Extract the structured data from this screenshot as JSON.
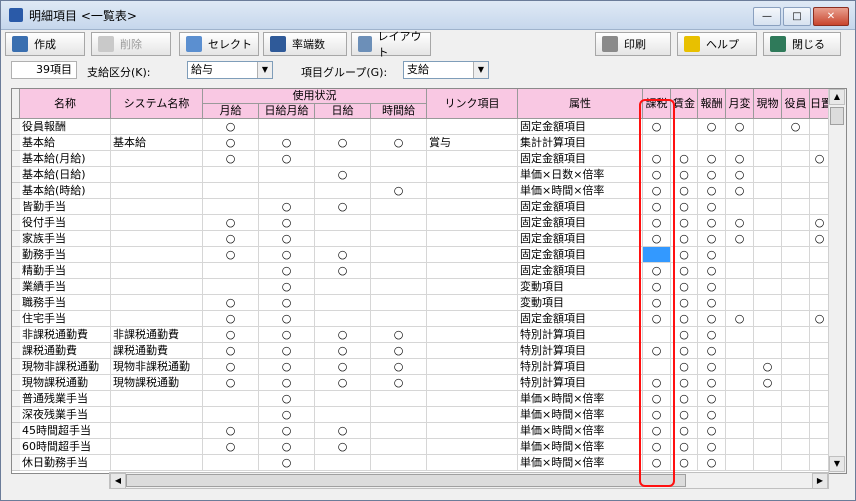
{
  "window": {
    "title": "明細項目 <一覧表>"
  },
  "toolbar": {
    "create": "作成",
    "delete": "削除",
    "select": "セレクト",
    "rounding": "率端数",
    "layout": "レイアウト",
    "print": "印刷",
    "help": "ヘルプ",
    "close": "閉じる"
  },
  "filters": {
    "count": "39項目",
    "payment_label": "支給区分(K):",
    "payment_value": "給与",
    "group_label": "項目グループ(G):",
    "group_value": "支給"
  },
  "columns": {
    "name": "名称",
    "system_name": "システム名称",
    "usage": "使用状況",
    "monthly": "月給",
    "daily_monthly": "日給月給",
    "daily": "日給",
    "hourly": "時間給",
    "link": "リンク項目",
    "attribute": "属性",
    "tax": "課税",
    "wage": "賃金",
    "remuneration": "報酬",
    "monthly_change": "月変",
    "in_kind": "現物",
    "officer": "役員",
    "daily_cut": "日置"
  },
  "rows": [
    {
      "name": "役員報酬",
      "sys": "",
      "m": "○",
      "dm": "",
      "d": "",
      "h": "",
      "link": "",
      "attr": "固定金額項目",
      "tax": "○",
      "wage": "",
      "rem": "○",
      "mc": "○",
      "ik": "",
      "off": "○",
      "dc": ""
    },
    {
      "name": "基本給",
      "sys": "基本給",
      "m": "○",
      "dm": "○",
      "d": "○",
      "h": "○",
      "link": "賞与",
      "attr": "集計計算項目",
      "tax": "",
      "wage": "",
      "rem": "",
      "mc": "",
      "ik": "",
      "off": "",
      "dc": ""
    },
    {
      "name": "基本給(月給)",
      "sys": "",
      "m": "○",
      "dm": "○",
      "d": "",
      "h": "",
      "link": "",
      "attr": "固定金額項目",
      "tax": "○",
      "wage": "○",
      "rem": "○",
      "mc": "○",
      "ik": "",
      "off": "",
      "dc": "○"
    },
    {
      "name": "基本給(日給)",
      "sys": "",
      "m": "",
      "dm": "",
      "d": "○",
      "h": "",
      "link": "",
      "attr": "単価×日数×倍率",
      "tax": "○",
      "wage": "○",
      "rem": "○",
      "mc": "○",
      "ik": "",
      "off": "",
      "dc": ""
    },
    {
      "name": "基本給(時給)",
      "sys": "",
      "m": "",
      "dm": "",
      "d": "",
      "h": "○",
      "link": "",
      "attr": "単価×時間×倍率",
      "tax": "○",
      "wage": "○",
      "rem": "○",
      "mc": "○",
      "ik": "",
      "off": "",
      "dc": ""
    },
    {
      "name": "皆勤手当",
      "sys": "",
      "m": "",
      "dm": "○",
      "d": "○",
      "h": "",
      "link": "",
      "attr": "固定金額項目",
      "tax": "○",
      "wage": "○",
      "rem": "○",
      "mc": "",
      "ik": "",
      "off": "",
      "dc": ""
    },
    {
      "name": "役付手当",
      "sys": "",
      "m": "○",
      "dm": "○",
      "d": "",
      "h": "",
      "link": "",
      "attr": "固定金額項目",
      "tax": "○",
      "wage": "○",
      "rem": "○",
      "mc": "○",
      "ik": "",
      "off": "",
      "dc": "○"
    },
    {
      "name": "家族手当",
      "sys": "",
      "m": "○",
      "dm": "○",
      "d": "",
      "h": "",
      "link": "",
      "attr": "固定金額項目",
      "tax": "○",
      "wage": "○",
      "rem": "○",
      "mc": "○",
      "ik": "",
      "off": "",
      "dc": "○"
    },
    {
      "name": "勤務手当",
      "sys": "",
      "m": "○",
      "dm": "○",
      "d": "○",
      "h": "",
      "link": "",
      "attr": "固定金額項目",
      "tax": "",
      "wage": "○",
      "rem": "○",
      "mc": "",
      "ik": "",
      "off": "",
      "dc": ""
    },
    {
      "name": "精勤手当",
      "sys": "",
      "m": "",
      "dm": "○",
      "d": "○",
      "h": "",
      "link": "",
      "attr": "固定金額項目",
      "tax": "○",
      "wage": "○",
      "rem": "○",
      "mc": "",
      "ik": "",
      "off": "",
      "dc": ""
    },
    {
      "name": "業績手当",
      "sys": "",
      "m": "",
      "dm": "○",
      "d": "",
      "h": "",
      "link": "",
      "attr": "変動項目",
      "tax": "○",
      "wage": "○",
      "rem": "○",
      "mc": "",
      "ik": "",
      "off": "",
      "dc": ""
    },
    {
      "name": "職務手当",
      "sys": "",
      "m": "○",
      "dm": "○",
      "d": "",
      "h": "",
      "link": "",
      "attr": "変動項目",
      "tax": "○",
      "wage": "○",
      "rem": "○",
      "mc": "",
      "ik": "",
      "off": "",
      "dc": ""
    },
    {
      "name": "住宅手当",
      "sys": "",
      "m": "○",
      "dm": "○",
      "d": "",
      "h": "",
      "link": "",
      "attr": "固定金額項目",
      "tax": "○",
      "wage": "○",
      "rem": "○",
      "mc": "○",
      "ik": "",
      "off": "",
      "dc": "○"
    },
    {
      "name": "非課税通勤費",
      "sys": "非課税通勤費",
      "m": "○",
      "dm": "○",
      "d": "○",
      "h": "○",
      "link": "",
      "attr": "特別計算項目",
      "tax": "",
      "wage": "○",
      "rem": "○",
      "mc": "",
      "ik": "",
      "off": "",
      "dc": ""
    },
    {
      "name": "課税通勤費",
      "sys": "課税通勤費",
      "m": "○",
      "dm": "○",
      "d": "○",
      "h": "○",
      "link": "",
      "attr": "特別計算項目",
      "tax": "○",
      "wage": "○",
      "rem": "○",
      "mc": "",
      "ik": "",
      "off": "",
      "dc": ""
    },
    {
      "name": "現物非課税通勤",
      "sys": "現物非課税通勤",
      "m": "○",
      "dm": "○",
      "d": "○",
      "h": "○",
      "link": "",
      "attr": "特別計算項目",
      "tax": "",
      "wage": "○",
      "rem": "○",
      "mc": "",
      "ik": "○",
      "off": "",
      "dc": ""
    },
    {
      "name": "現物課税通勤",
      "sys": "現物課税通勤",
      "m": "○",
      "dm": "○",
      "d": "○",
      "h": "○",
      "link": "",
      "attr": "特別計算項目",
      "tax": "○",
      "wage": "○",
      "rem": "○",
      "mc": "",
      "ik": "○",
      "off": "",
      "dc": ""
    },
    {
      "name": "普通残業手当",
      "sys": "",
      "m": "",
      "dm": "○",
      "d": "",
      "h": "",
      "link": "",
      "attr": "単価×時間×倍率",
      "tax": "○",
      "wage": "○",
      "rem": "○",
      "mc": "",
      "ik": "",
      "off": "",
      "dc": ""
    },
    {
      "name": "深夜残業手当",
      "sys": "",
      "m": "",
      "dm": "○",
      "d": "",
      "h": "",
      "link": "",
      "attr": "単価×時間×倍率",
      "tax": "○",
      "wage": "○",
      "rem": "○",
      "mc": "",
      "ik": "",
      "off": "",
      "dc": ""
    },
    {
      "name": "45時間超手当",
      "sys": "",
      "m": "○",
      "dm": "○",
      "d": "○",
      "h": "",
      "link": "",
      "attr": "単価×時間×倍率",
      "tax": "○",
      "wage": "○",
      "rem": "○",
      "mc": "",
      "ik": "",
      "off": "",
      "dc": ""
    },
    {
      "name": "60時間超手当",
      "sys": "",
      "m": "○",
      "dm": "○",
      "d": "○",
      "h": "",
      "link": "",
      "attr": "単価×時間×倍率",
      "tax": "○",
      "wage": "○",
      "rem": "○",
      "mc": "",
      "ik": "",
      "off": "",
      "dc": ""
    },
    {
      "name": "休日勤務手当",
      "sys": "",
      "m": "",
      "dm": "○",
      "d": "",
      "h": "",
      "link": "",
      "attr": "単価×時間×倍率",
      "tax": "○",
      "wage": "○",
      "rem": "○",
      "mc": "",
      "ik": "",
      "off": "",
      "dc": ""
    }
  ]
}
